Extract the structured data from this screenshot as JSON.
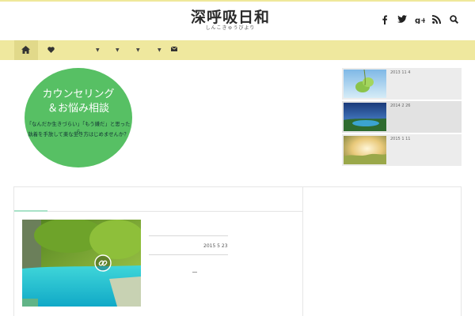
{
  "header": {
    "logo_main": "深呼吸日和",
    "logo_sub": "しんこきゅうびより",
    "social": [
      "facebook-icon",
      "twitter-icon",
      "google-plus-icon",
      "rss-icon",
      "search-icon"
    ]
  },
  "nav": {
    "icons": [
      "home-icon",
      "heart-icon",
      "envelope-icon"
    ],
    "dropdowns": 4
  },
  "hero": {
    "line1": "カウンセリング",
    "line2": "＆お悩み相談",
    "sub1": "「なんだか生きづらい」「もう嫌だ」と思ったら",
    "sub2": "執着を手放して楽な生き方はじめませんか？"
  },
  "sidebar_posts": [
    {
      "date": "2013 11 4"
    },
    {
      "date": "2014 2 26"
    },
    {
      "date": "2015 1 11"
    }
  ],
  "main_post": {
    "date": "2015 5 23",
    "icon": "link-icon"
  },
  "colors": {
    "nav_bg": "#efe89e",
    "hero_green": "#57c064",
    "accent": "#a8e2c8"
  }
}
